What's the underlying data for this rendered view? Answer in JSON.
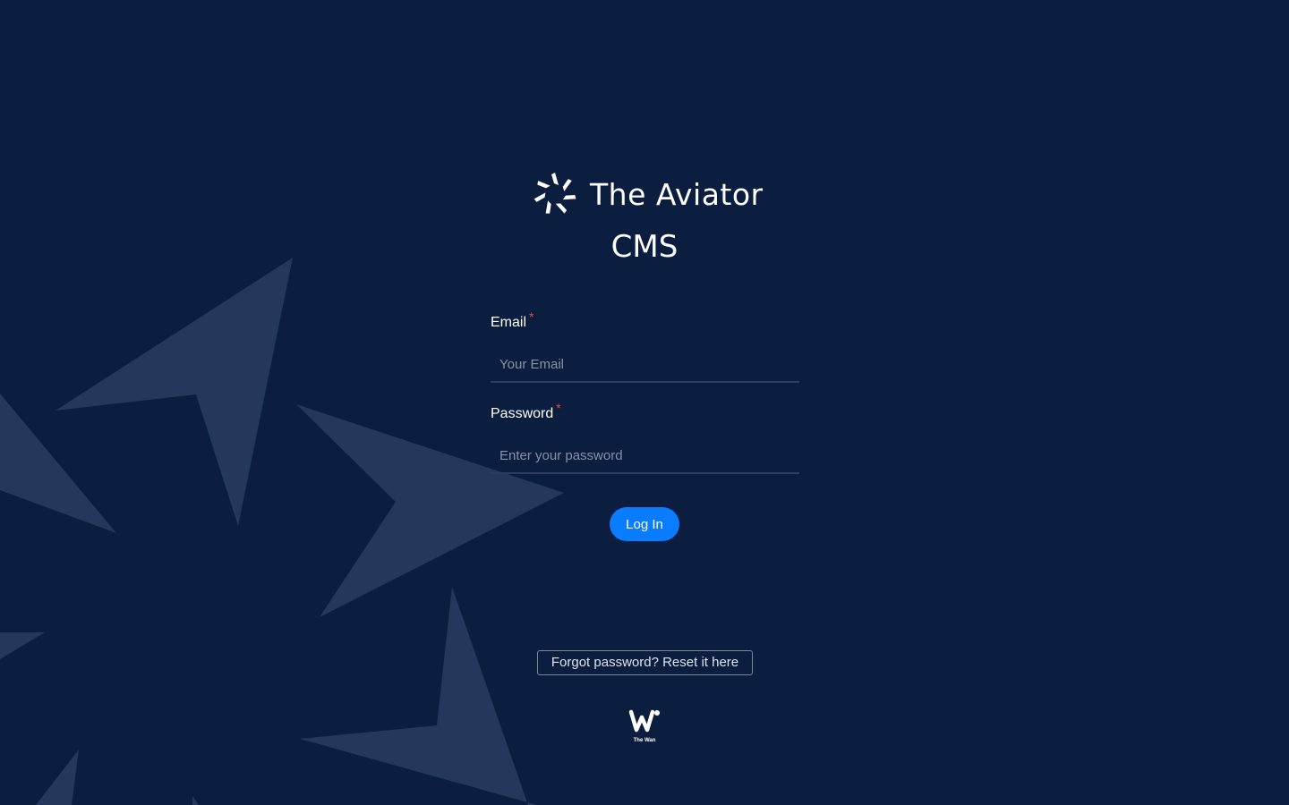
{
  "brand": {
    "name": "The Aviator",
    "subtitle": "CMS"
  },
  "form": {
    "email": {
      "label": "Email",
      "required_mark": "*",
      "placeholder": "Your Email",
      "value": ""
    },
    "password": {
      "label": "Password",
      "required_mark": "*",
      "placeholder": "Enter your password",
      "value": ""
    },
    "submit_label": "Log In"
  },
  "forgot_password": {
    "label": "Forgot password? Reset it here"
  },
  "footer": {
    "logo_icon": "the-wan-logo",
    "logo_text": "The Wan"
  },
  "colors": {
    "background": "#0b1e3f",
    "background_shape": "#23385a",
    "primary_button": "#0a7cff",
    "required_mark": "#e5484d"
  }
}
